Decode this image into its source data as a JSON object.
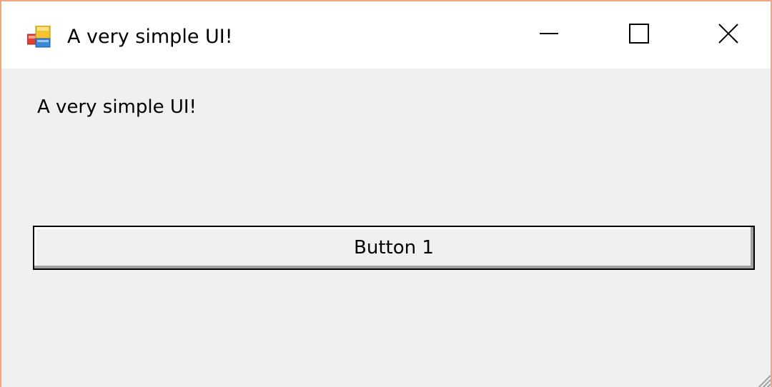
{
  "window": {
    "title": "A very simple UI!",
    "icon": "app-window-icon",
    "border_color": "#f0a583",
    "caption_buttons": [
      "minimize-icon",
      "maximize-icon",
      "close-icon"
    ]
  },
  "content": {
    "label_text": "A very simple UI!",
    "button_label": "Button 1"
  },
  "colors": {
    "client_background": "#f0f0f0",
    "titlebar_background": "#ffffff"
  }
}
